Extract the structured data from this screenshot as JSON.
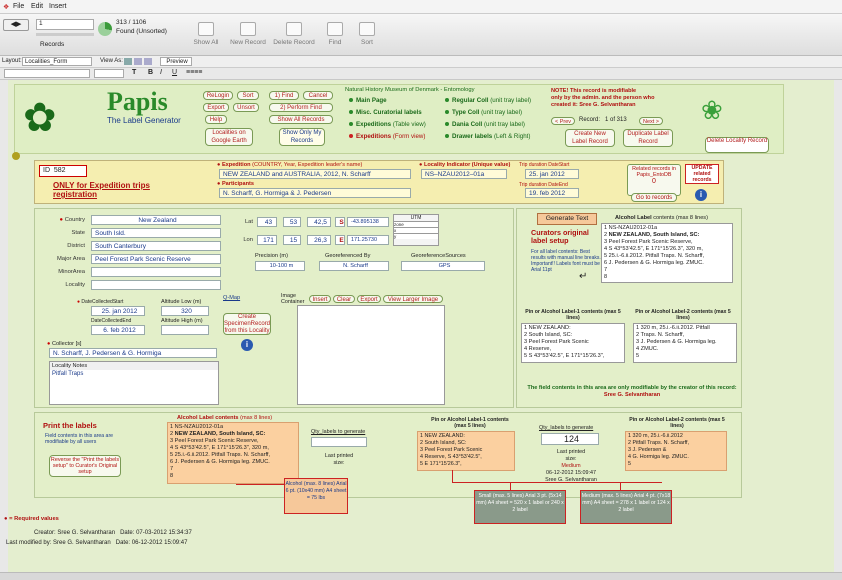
{
  "menu": {
    "file": "File",
    "edit": "Edit",
    "insert": "Insert"
  },
  "toolbar": {
    "record_number": "1",
    "records_label": "Records",
    "record_total": "313 / 1106",
    "found_label": "Found (Unsorted)",
    "show_all": "Show All",
    "new_record": "New Record",
    "delete_record": "Delete Record",
    "find": "Find",
    "sort": "Sort"
  },
  "layoutbar": {
    "layout_label": "Layout:",
    "layout_value": "Localities_Form",
    "view_as": "View As:",
    "preview": "Preview"
  },
  "formatbar": {
    "bold": "B",
    "italic": "I",
    "underline": "U",
    "text": "T"
  },
  "header": {
    "logo": "Papis",
    "subtitle": "The Label Generator",
    "relogin": "ReLogin",
    "sort": "Sort",
    "export": "Export",
    "unsort": "Unsort",
    "help": "Help",
    "find1": "1) Find",
    "cancel": "Cancel",
    "perform_find": "2) Perform Find",
    "show_all_records": "Show All Records",
    "google_earth": "Localities on Google Earth",
    "show_only_my": "Show Only My Records",
    "museum": "Natural History Museum of Denmark - Entomology",
    "nav_main": "Main Page",
    "nav_misc": "Misc. Curatorial labels",
    "nav_exp_table": "Expeditions",
    "nav_exp_table_note": "(Table view)",
    "nav_exp_form": "Expeditions",
    "nav_exp_form_note": "(Form view)",
    "nav_regular": "Regular Coll",
    "nav_regular_note": "(unit tray label)",
    "nav_type": "Type Coll",
    "nav_type_note": "(unit tray label)",
    "nav_dania": "Dania Coll",
    "nav_dania_note": "(unit tray label)",
    "nav_drawer": "Drawer labels",
    "nav_drawer_note": "(Left & Right)",
    "note_title": "NOTE! This record is modifiable",
    "note_body": "only by the admin. and the person who created it:",
    "note_person": "Sree G. Selvantharan",
    "prev": "< Prev",
    "record_label": "Record:",
    "record_pos": "1 of 313",
    "next": "Next >",
    "create_new": "Create New Label Record",
    "duplicate": "Duplicate Label Record",
    "delete": "Delete Locality Record"
  },
  "expedition": {
    "id_label": "ID",
    "id_value": "582",
    "only_for": "ONLY for Expedition trips registration",
    "exp_label": "Expedition",
    "exp_note": "(COUNTRY, Year, Expedition leader's name)",
    "exp_value": "NEW ZEALAND and AUSTRALIA, 2012, N. Scharff",
    "part_label": "Participants",
    "part_value": "N. Scharff, G. Hormiga & J. Pedersen",
    "loc_ind_label": "Locality Indicator (Unique value)",
    "loc_ind_value": "NS–NZAU2012–01a",
    "trip_start_label": "Trip duration DateStart",
    "trip_start": "25. jan 2012",
    "trip_end_label": "Trip duration DateEnd",
    "trip_end": "19. feb 2012",
    "related_label": "Related records in Papis_EntoDB",
    "related_value": "0",
    "update_label": "UPDATE related records",
    "goto": "Go to records"
  },
  "locality": {
    "country_label": "Country",
    "country": "New Zealand",
    "state_label": "State",
    "state": "South Isld.",
    "district_label": "District",
    "district": "South Canterbury",
    "major_label": "Major Area",
    "major": "Peel Forest Park Scenic Reserve",
    "minor_label": "MinorArea",
    "minor": "",
    "locality_label": "Locality",
    "locality": "",
    "lat_label": "Lat",
    "lat_d": "43",
    "lat_m": "53",
    "lat_s": "42,5",
    "lat_h": "S",
    "lat_dec": "-43.895138",
    "lon_label": "Lon",
    "lon_d": "171",
    "lon_m": "15",
    "lon_s": "26,3",
    "lon_h": "E",
    "lon_dec": "171.25730",
    "utm": "UTM",
    "zone": "zone",
    "x": "x",
    "y": "y",
    "precision_label": "Precision (m)",
    "precision": "10-100 m",
    "georef_by_label": "Georeferenced By",
    "georef_by": "N. Scharff",
    "georef_src_label": "GeoreferenceSources",
    "georef_src": "GPS",
    "dcs_label": "DateCollectedStart",
    "dcs": "25. jan 2012",
    "dce_label": "DateCollectedEnd",
    "dce": "6. feb 2012",
    "alt_low_label": "Altitude Low (m)",
    "alt_low": "320",
    "alt_high_label": "Altitude High (m)",
    "alt_high": "",
    "qmap": "Q-Map",
    "create_specimen": "Create SpecimenRecord from this Locality",
    "image_label": "Image Container",
    "insert": "Insert",
    "clear": "Clear",
    "export": "Export",
    "view_larger": "View Larger Image",
    "collector_label": "Collector [s]",
    "collector": "N. Scharff, J. Pedersen & G. Hormiga",
    "notes_label": "Locality Notes",
    "notes": "Pitfall Traps"
  },
  "generate": {
    "button": "Generate Text",
    "curators_title": "Curators original label setup",
    "curators_body": "For all label contents: Best results with manual line breaks. Important!! Labels font must be Arial 11pt",
    "alc_title": "Alcohol Label",
    "alc_note": "contents (max 8 lines)",
    "alc_lines": [
      "NS-NZAU2012-01a",
      "NEW ZEALAND, South Island, SC:",
      "Peel Forest Park Scenic Reserve,",
      "S 43°53'42.5\", E 171°15'26.3\", 320 m,",
      "25.i.-6.ii.2012. Pitfall Traps. N. Scharff,",
      "J. Pedersen & G. Hormiga leg. ZMUC.",
      "",
      ""
    ],
    "pin1_title": "Pin or Alcohol Label-1 contents (max 5 lines)",
    "pin1_lines": [
      "NEW ZEALAND:",
      "South Island, SC:",
      "Peel Forest Park Scenic",
      "Reserve,",
      "S 43°53'42.5\", E 171°15'26.3\","
    ],
    "pin2_title": "Pin or Alcohol Label-2 contents (max 5 lines)",
    "pin2_lines": [
      "320 m, 25.i.-6.ii.2012. Pitfall",
      "Traps. N. Scharff,",
      "J. Pedersen & G. Hormiga leg.",
      "ZMUC.",
      ""
    ],
    "modnote": "The field contents in this area are only modifiable by the creator of this record:",
    "modperson": "Sree G. Selvantharan"
  },
  "print": {
    "title": "Print the labels",
    "field_note": "Field contents in this area are modifiable by all users",
    "reverse": "Reverse the \"Print the labels setup\" to Curator's Original setup",
    "alc_title": "Alcohol Label contents",
    "alc_note": "(max 8 lines)",
    "alc_lines": [
      "NS-NZAU2012-01a",
      "NEW ZEALAND, South Island, SC:",
      "Peel Forest Park Scenic Reserve,",
      "S 43°53'42.5\", E 171°15'26.3\", 320 m,",
      "25.i.-6.ii.2012. Pitfall Traps. N. Scharff,",
      "J. Pedersen & G. Hormiga leg. ZMUC.",
      "",
      ""
    ],
    "qty_label": "Qty_labels to generate",
    "qty1": "",
    "last_printed": "Last printed size:",
    "alc_small": "Alcohol (max. 8 lines) Arial 6 pt. (10x40 mm) A4 sheet = 75 lbs",
    "pin1_title": "Pin or Alcohol Label-1 contents (max 5 lines)",
    "pin1_lines": [
      "NEW ZEALAND:",
      "South Island, SC:",
      "Peel Forest Park Scenic",
      "Reserve, S 43°53'42.5\",",
      "E 171°15'26.3\","
    ],
    "qty2": "124",
    "last_printed2": "Last printed size:",
    "last_size": "Medium",
    "last_date": "06-12-2012 15:09:47",
    "last_person": "Sree G. Selvantharan",
    "pin2_title": "Pin or Alcohol Label-2 contents (max 5 lines)",
    "pin2_lines": [
      "320 m, 25.i.-6.ii.2012",
      "Pitfall Traps. N. Scharff,",
      "J. Pedersen &",
      "G. Hormiga leg. ZMUC.",
      ""
    ],
    "small": "Small (max. 5 lines) Arial 3 pt. (5x14 mm) A4 sheet = 520 x 1 label or 240 x 2 label",
    "medium": "Medium (max. 5 lines) Arial 4 pt. (7x18 mm) A4 sheet = 278 x 1 label or 124 x 2 label"
  },
  "footer": {
    "required": "= Required values",
    "creator_label": "Creator:",
    "creator": "Sree G. Selvantharan",
    "date_label": "Date:",
    "created": "07-03-2012 15:34:37",
    "modified_label": "Last modified by:",
    "modifier": "Sree G. Selvantharan",
    "modified": "06-12-2012 15:09:47"
  }
}
